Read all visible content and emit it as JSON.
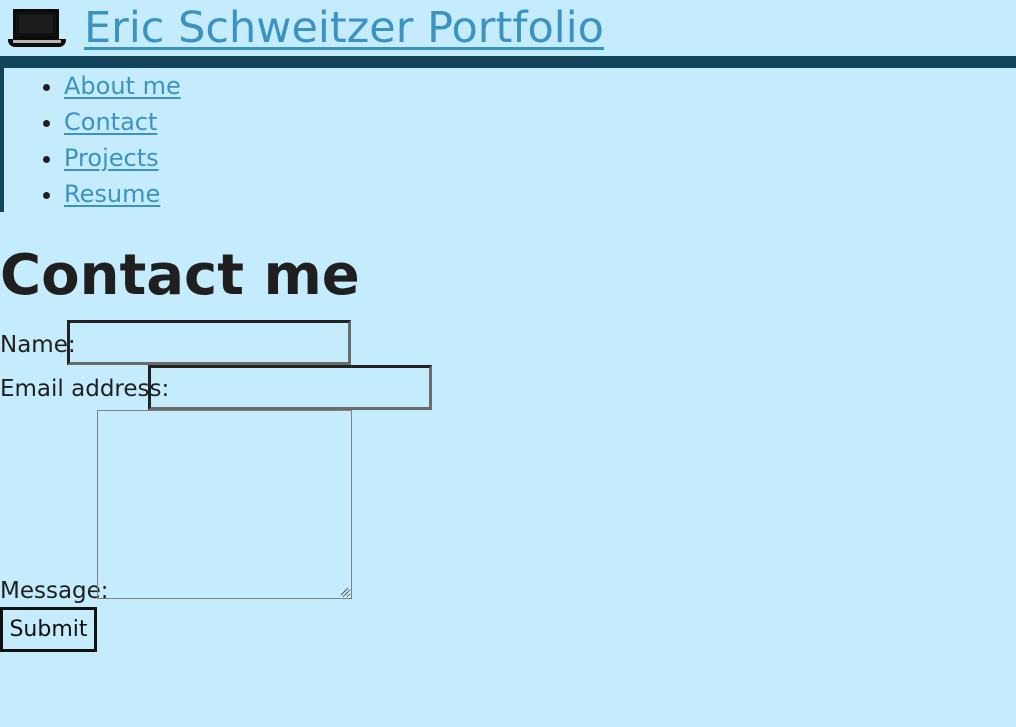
{
  "site": {
    "title": "Eric Schweitzer Portfolio",
    "title_icon": "laptop-icon",
    "colors": {
      "page_background": "#c4ecfc",
      "link": "#3b93c4",
      "header_rule": "#12445a",
      "text": "#1f1f1f"
    }
  },
  "navigation": {
    "items": [
      {
        "label": "About me"
      },
      {
        "label": "Contact"
      },
      {
        "label": "Projects"
      },
      {
        "label": "Resume"
      }
    ]
  },
  "page": {
    "title": "Contact me"
  },
  "form": {
    "name": {
      "label": "Name:",
      "value": ""
    },
    "email": {
      "label": "Email address:",
      "value": ""
    },
    "message": {
      "label": "Message:",
      "value": ""
    },
    "submit_label": "Submit"
  }
}
